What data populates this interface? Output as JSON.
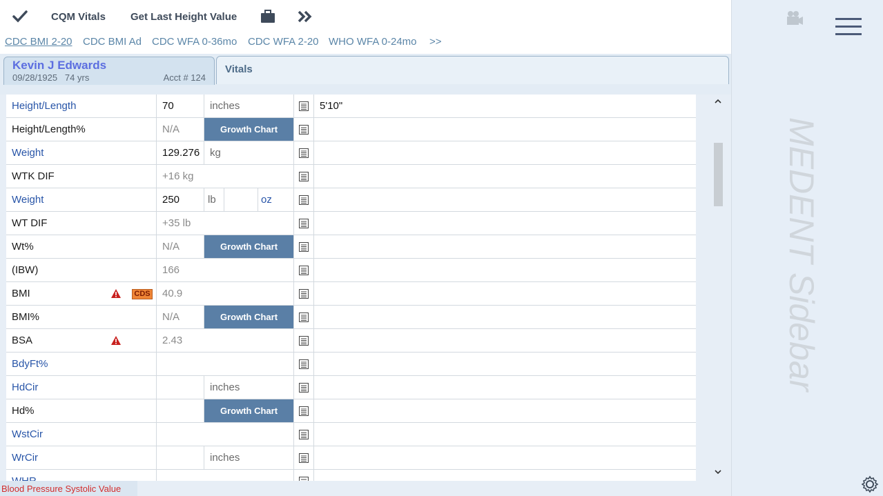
{
  "toolbar": {
    "check_icon": "checkmark-icon",
    "cqm_vitals": "CQM Vitals",
    "get_last_height": "Get Last Height Value",
    "briefcase_icon": "briefcase-icon",
    "forward_icon": "double-chevron-right-icon"
  },
  "links": [
    "CDC BMI 2-20",
    "CDC BMI Ad",
    "CDC WFA 0-36mo",
    "CDC WFA 2-20",
    "WHO WFA 0-24mo",
    ">>"
  ],
  "patient": {
    "name": "Kevin J Edwards",
    "dob": "09/28/1925",
    "age": "74 yrs",
    "acct": "Acct # 124"
  },
  "tab": {
    "vitals": "Vitals"
  },
  "rows": {
    "height": {
      "label": "Height/Length",
      "value": "70",
      "unit": "inches",
      "comment": "5'10\""
    },
    "height_pct": {
      "label": "Height/Length%",
      "value": "N/A",
      "button": "Growth Chart"
    },
    "weight_kg": {
      "label": "Weight",
      "value": "129.276",
      "unit": "kg"
    },
    "wtk_dif": {
      "label": "WTK DIF",
      "value": "+16 kg"
    },
    "weight_lb": {
      "label": "Weight",
      "value": "250",
      "unit": "lb",
      "unit2": "oz"
    },
    "wt_dif": {
      "label": "WT DIF",
      "value": "+35 lb"
    },
    "wt_pct": {
      "label": "Wt%",
      "value": "N/A",
      "button": "Growth Chart"
    },
    "ibw": {
      "label": "(IBW)",
      "value": "166"
    },
    "bmi": {
      "label": "BMI",
      "value": "40.9",
      "badge": "CDS"
    },
    "bmi_pct": {
      "label": "BMI%",
      "value": "N/A",
      "button": "Growth Chart"
    },
    "bsa": {
      "label": "BSA",
      "value": "2.43"
    },
    "bdyft": {
      "label": "BdyFt%"
    },
    "hdcir": {
      "label": "HdCir",
      "unit": "inches"
    },
    "hd_pct": {
      "label": "Hd%",
      "button": "Growth Chart"
    },
    "wstcir": {
      "label": "WstCir"
    },
    "wrcir": {
      "label": "WrCir",
      "unit": "inches"
    },
    "whr": {
      "label": "WHR"
    }
  },
  "status": {
    "text": "Blood Pressure Systolic Value"
  },
  "sidebar": {
    "title": "MEDENT Sidebar"
  },
  "colors": {
    "accent": "#5a7fa6",
    "link": "#2855a8",
    "status_red": "#d12c2c",
    "cds_orange": "#ef8536"
  }
}
